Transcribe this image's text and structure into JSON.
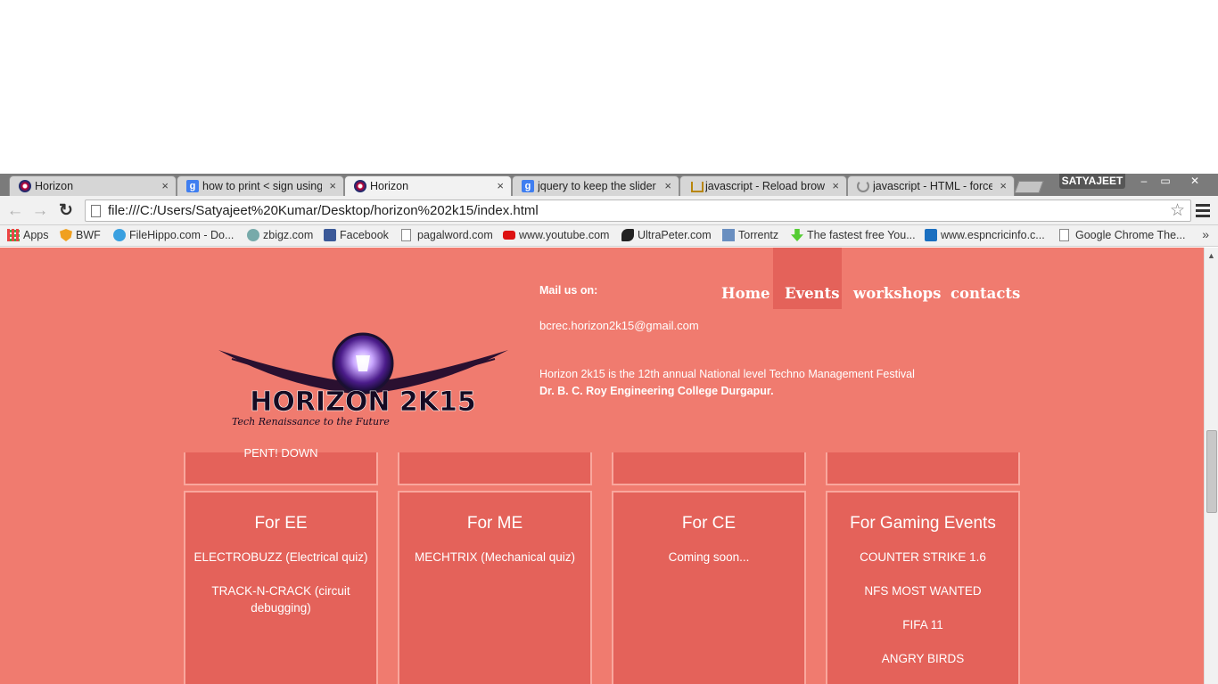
{
  "browser": {
    "tabs": [
      {
        "label": "Horizon",
        "icon": "horizon-favicon"
      },
      {
        "label": "how to print < sign using",
        "icon": "google-favicon"
      },
      {
        "label": "Horizon",
        "icon": "horizon-favicon"
      },
      {
        "label": "jquery to keep the slider a",
        "icon": "google-favicon"
      },
      {
        "label": "javascript - Reload brows",
        "icon": "stackoverflow-favicon"
      },
      {
        "label": "javascript - HTML - force",
        "icon": "loading-spinner"
      }
    ],
    "close_glyph": "×",
    "profile_name": "SATYAJEET",
    "window_controls": {
      "minimize": "–",
      "restore": "▭",
      "close": "✕"
    },
    "nav": {
      "back": "←",
      "forward": "→",
      "reload": "↻"
    },
    "url": "file:///C:/Users/Satyajeet%20Kumar/Desktop/horizon%202k15/index.html",
    "star": "☆",
    "bookmarks": [
      "Apps",
      "BWF",
      "FileHippo.com - Do...",
      "zbigz.com",
      "Facebook",
      "pagalword.com",
      "www.youtube.com",
      "UltraPeter.com",
      "Torrentz",
      "The fastest free You...",
      "www.espncricinfo.c...",
      "Google Chrome The..."
    ],
    "bookmarks_more": "»"
  },
  "site": {
    "logo_text": "HORIZON 2K15",
    "logo_tagline": "Tech Renaissance to the Future",
    "mail_label": "Mail us on:",
    "mail_value": "bcrec.horizon2k15@gmail.com",
    "description_line1": "Horizon 2k15 is the 12th annual National level Techno Management Festival",
    "description_line2": "Dr. B. C. Roy Engineering College Durgapur.",
    "nav": {
      "home": "Home",
      "events": "Events",
      "workshops": "workshops",
      "contacts": "contacts"
    },
    "partial_card_text": "PENT! DOWN",
    "cards": [
      {
        "title": "For EE",
        "items": [
          "ELECTROBUZZ (Electrical quiz)",
          "TRACK-N-CRACK (circuit debugging)"
        ]
      },
      {
        "title": "For ME",
        "items": [
          "MECHTRIX (Mechanical quiz)"
        ]
      },
      {
        "title": "For CE",
        "items": [
          "Coming soon..."
        ]
      },
      {
        "title": "For Gaming Events",
        "items": [
          "COUNTER STRIKE 1.6",
          "NFS MOST WANTED",
          "FIFA 11",
          "ANGRY BIRDS"
        ]
      }
    ]
  },
  "colors": {
    "page_bg": "#f07b6f",
    "card_bg": "#e4625a",
    "card_border": "#f9a79d",
    "tabstrip_bg": "#7b7b7b"
  }
}
